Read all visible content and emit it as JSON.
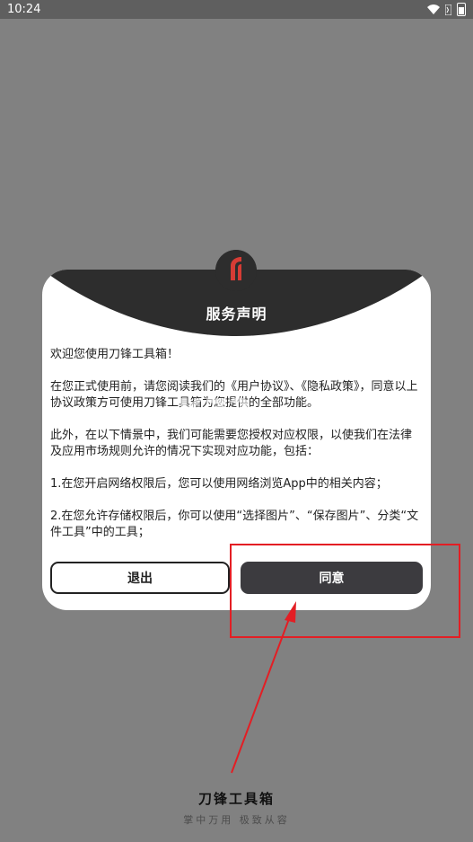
{
  "status": {
    "time": "10:24"
  },
  "dialog": {
    "title": "服务声明",
    "paragraphs": [
      "欢迎您使用刀锋工具箱！",
      "在您正式使用前，请您阅读我们的《用户协议》、《隐私政策》，同意以上协议政策方可使用刀锋工具箱为您提供的全部功能。",
      "此外，在以下情景中，我们可能需要您授权对应权限，以使我们在法律及应用市场规则允许的情况下实现对应功能，包括：",
      "1.在您开启网络权限后，您可以使用网络浏览App中的相关内容；",
      "2.在您允许存储权限后，你可以使用“选择图片”、“保存图片”、分类“文件工具”中的工具；"
    ],
    "exit_label": "退出",
    "agree_label": "同意"
  },
  "brand": {
    "name": "刀锋工具箱",
    "slogan": "掌中万用 极致从容"
  },
  "watermark": "K73",
  "colors": {
    "background": "#818181",
    "dialog_header": "#2d2d2d",
    "agree_button": "#3c3b3f",
    "annotation": "#e31e24"
  },
  "icons": [
    "wifi-icon",
    "data-icon",
    "battery-icon",
    "app-logo-icon"
  ]
}
